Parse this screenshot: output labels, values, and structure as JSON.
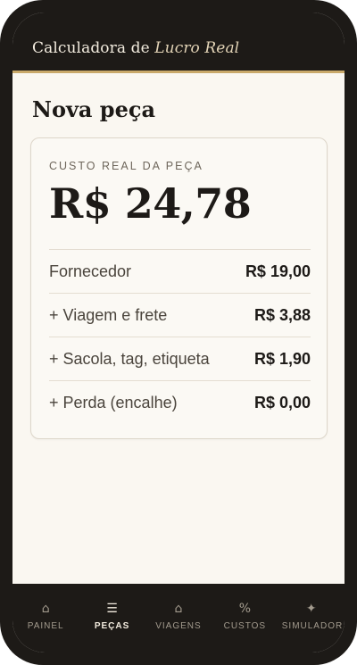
{
  "header": {
    "title_prefix": "Calculadora de ",
    "title_emphasis": "Lucro Real"
  },
  "page": {
    "title": "Nova peça"
  },
  "card": {
    "label": "CUSTO REAL DA PEÇA",
    "total": "R$ 24,78",
    "rows": [
      {
        "label": "Fornecedor",
        "value": "R$ 19,00"
      },
      {
        "label": "+ Viagem e frete",
        "value": "R$ 3,88"
      },
      {
        "label": "+ Sacola, tag, etiqueta",
        "value": "R$ 1,90"
      },
      {
        "label": "+ Perda (encalhe)",
        "value": "R$ 0,00"
      }
    ]
  },
  "nav": {
    "active": "peças",
    "items": [
      {
        "icon": "⌂",
        "icon_name": "home-icon",
        "label": "PAINEL"
      },
      {
        "icon": "☰",
        "icon_name": "list-icon",
        "label": "PEÇAS"
      },
      {
        "icon": "⌂",
        "icon_name": "home-icon",
        "label": "VIAGENS"
      },
      {
        "icon": "%",
        "icon_name": "percent-icon",
        "label": "CUSTOS"
      },
      {
        "icon": "✦",
        "icon_name": "sparkle-icon",
        "label": "SIMULADOR"
      }
    ]
  },
  "colors": {
    "dark": "#1d1a17",
    "accent_gold": "#c9a96a",
    "background": "#faf7f1"
  }
}
